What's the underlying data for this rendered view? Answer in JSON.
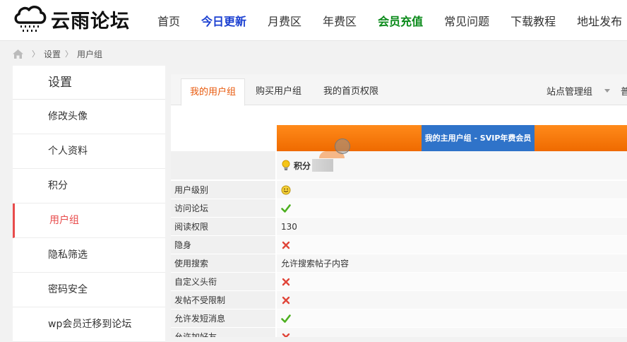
{
  "header": {
    "logo_text": "云雨论坛",
    "nav": [
      {
        "label": "首页",
        "style": "normal"
      },
      {
        "label": "今日更新",
        "style": "blue"
      },
      {
        "label": "月费区",
        "style": "normal"
      },
      {
        "label": "年费区",
        "style": "normal"
      },
      {
        "label": "会员充值",
        "style": "green"
      },
      {
        "label": "常见问题",
        "style": "normal"
      },
      {
        "label": "下载教程",
        "style": "normal"
      },
      {
        "label": "地址发布",
        "style": "normal"
      }
    ]
  },
  "breadcrumb": {
    "items": [
      "设置",
      "用户组"
    ]
  },
  "sidebar": {
    "title": "设置",
    "items": [
      {
        "label": "修改头像"
      },
      {
        "label": "个人资料"
      },
      {
        "label": "积分"
      },
      {
        "label": "用户组"
      },
      {
        "label": "隐私筛选"
      },
      {
        "label": "密码安全"
      },
      {
        "label": "wp会员迁移到论坛"
      }
    ]
  },
  "tabs": {
    "items": [
      "我的用户组",
      "购买用户组",
      "我的首页权限"
    ],
    "right": "站点管理组",
    "right_cut": "普"
  },
  "group": {
    "banner": "我的主用户组 - SVIP年费会员",
    "score_label": "积分"
  },
  "rows": [
    {
      "label": "用户级别",
      "value": "",
      "icon": "smiley-icon"
    },
    {
      "label": "访问论坛",
      "value": "",
      "icon": "check-icon"
    },
    {
      "label": "阅读权限",
      "value": "130",
      "icon": ""
    },
    {
      "label": "隐身",
      "value": "",
      "icon": "cross-icon"
    },
    {
      "label": "使用搜索",
      "value": "允许搜索帖子内容",
      "icon": ""
    },
    {
      "label": "自定义头衔",
      "value": "",
      "icon": "cross-icon"
    },
    {
      "label": "发帖不受限制",
      "value": "",
      "icon": "cross-icon"
    },
    {
      "label": "允许发短消息",
      "value": "",
      "icon": "check-icon"
    },
    {
      "label": "允许加好友",
      "value": "",
      "icon": "cross-icon"
    }
  ],
  "colors": {
    "accent_red": "#e84b4b",
    "tab_orange": "#e8590c",
    "nav_blue": "#1a3fd1",
    "nav_green": "#0a8a1a",
    "banner_orange": "#ff8a1a",
    "banner_blue": "#2f73c9",
    "check_green": "#4caf1f",
    "cross_red": "#e0463a"
  }
}
